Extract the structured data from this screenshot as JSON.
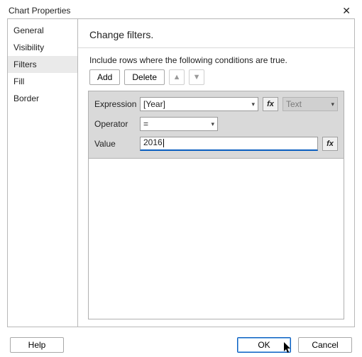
{
  "window": {
    "title": "Chart Properties"
  },
  "sidebar": {
    "items": [
      {
        "label": "General"
      },
      {
        "label": "Visibility"
      },
      {
        "label": "Filters"
      },
      {
        "label": "Fill"
      },
      {
        "label": "Border"
      }
    ],
    "selected_index": 2
  },
  "main": {
    "heading": "Change filters.",
    "subtitle": "Include rows where the following conditions are true.",
    "toolbar": {
      "add_label": "Add",
      "delete_label": "Delete"
    },
    "filter": {
      "expression_label": "Expression",
      "expression_value": "[Year]",
      "expression_type": "Text",
      "operator_label": "Operator",
      "operator_value": "=",
      "value_label": "Value",
      "value_value": "2016"
    }
  },
  "footer": {
    "help_label": "Help",
    "ok_label": "OK",
    "cancel_label": "Cancel"
  },
  "icons": {
    "fx": "fx"
  }
}
